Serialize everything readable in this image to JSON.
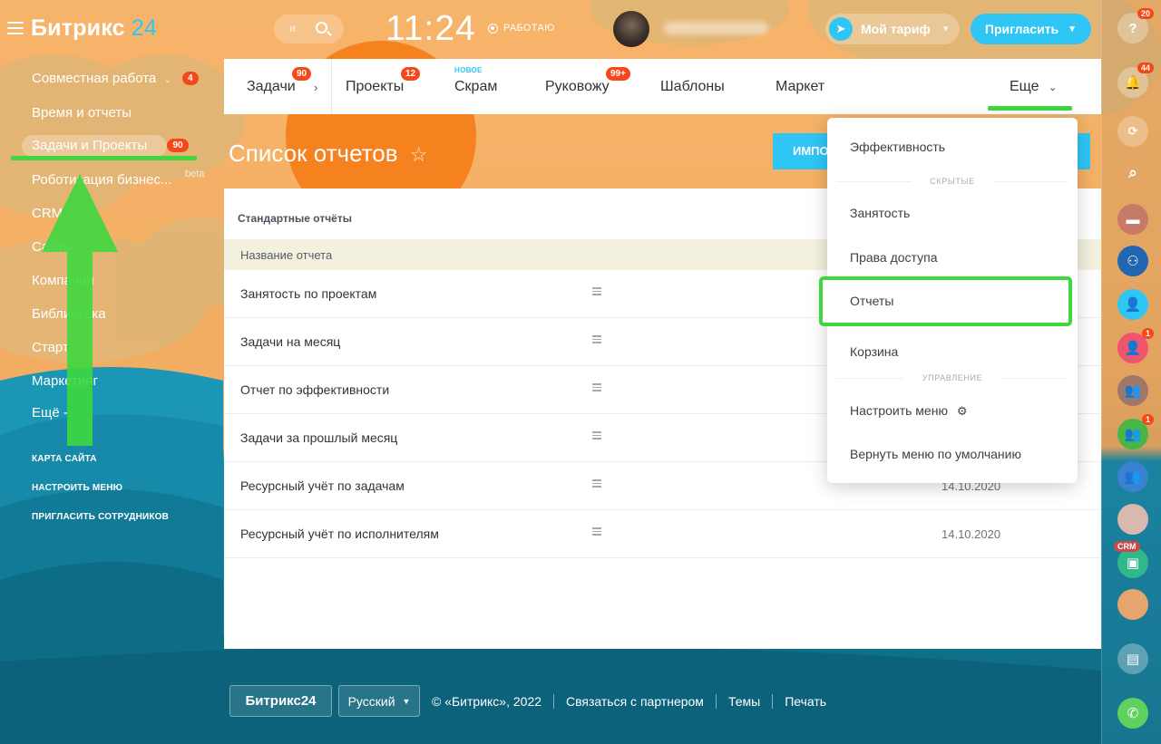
{
  "header": {
    "logo_name": "Битрикс",
    "logo_num": "24",
    "search_placeholder": "и",
    "clock": "11:24",
    "work_status": "РАБОТАЮ",
    "tariff_label": "Мой тариф",
    "invite_label": "Пригласить"
  },
  "sidebar": {
    "items": [
      {
        "label": "Совместная работа",
        "badge": "4"
      },
      {
        "label": "Время и отчеты"
      },
      {
        "label": "Задачи и Проекты",
        "badge": "90"
      },
      {
        "label": "Роботизация бизнес...",
        "tag": "beta"
      },
      {
        "label": "CRM"
      },
      {
        "label": "Сайты"
      },
      {
        "label": "Компания"
      },
      {
        "label": "Библиотека"
      },
      {
        "label": "Старт"
      },
      {
        "label": "Маркетинг"
      },
      {
        "label": "Ещё -"
      }
    ],
    "links": [
      "КАРТА САЙТА",
      "НАСТРОИТЬ МЕНЮ",
      "ПРИГЛАСИТЬ СОТРУДНИКОВ"
    ]
  },
  "tabs": {
    "items": [
      {
        "label": "Задачи",
        "badge": "90"
      },
      {
        "label": "Проекты",
        "badge": "12"
      },
      {
        "label": "Скрам",
        "tag": "НОВОЕ"
      },
      {
        "label": "Руковожу",
        "badge": "99+"
      },
      {
        "label": "Шаблоны"
      },
      {
        "label": "Маркет"
      },
      {
        "label": "Еще"
      }
    ]
  },
  "page": {
    "title": "Список отчетов",
    "import_button": "ИМПО"
  },
  "reports": {
    "section_title": "Стандартные отчёты",
    "column_name": "Название отчета",
    "rows": [
      {
        "name": "Занятость по проектам",
        "date": ""
      },
      {
        "name": "Задачи на месяц",
        "date": ""
      },
      {
        "name": "Отчет по эффективности",
        "date": ""
      },
      {
        "name": "Задачи за прошлый месяц",
        "date": ""
      },
      {
        "name": "Ресурсный учёт по задачам",
        "date": "14.10.2020"
      },
      {
        "name": "Ресурсный учёт по исполнителям",
        "date": "14.10.2020"
      }
    ]
  },
  "dropdown": {
    "item_efficiency": "Эффективность",
    "head_hidden": "СКРЫТЫЕ",
    "item_busy": "Занятость",
    "item_access": "Права доступа",
    "item_reports": "Отчеты",
    "item_trash": "Корзина",
    "head_manage": "УПРАВЛЕНИЕ",
    "item_configure": "Настроить меню",
    "item_reset": "Вернуть меню по умолчанию"
  },
  "rightbar": {
    "help_badge": "20",
    "notif_badge": "44",
    "contact_badge_1": "1",
    "contact_badge_2": "1",
    "crm_tag": "CRM"
  },
  "footer": {
    "logo": "Битрикс24",
    "language": "Русский",
    "copyright": "© «Битрикс», 2022",
    "partner": "Связаться с партнером",
    "themes": "Темы",
    "print": "Печать"
  },
  "colors": {
    "accent": "#2fc6f6",
    "badge": "#f54819",
    "highlight_green": "#3ed73e",
    "sea": "#167b98",
    "sand": "#f3ad62"
  }
}
